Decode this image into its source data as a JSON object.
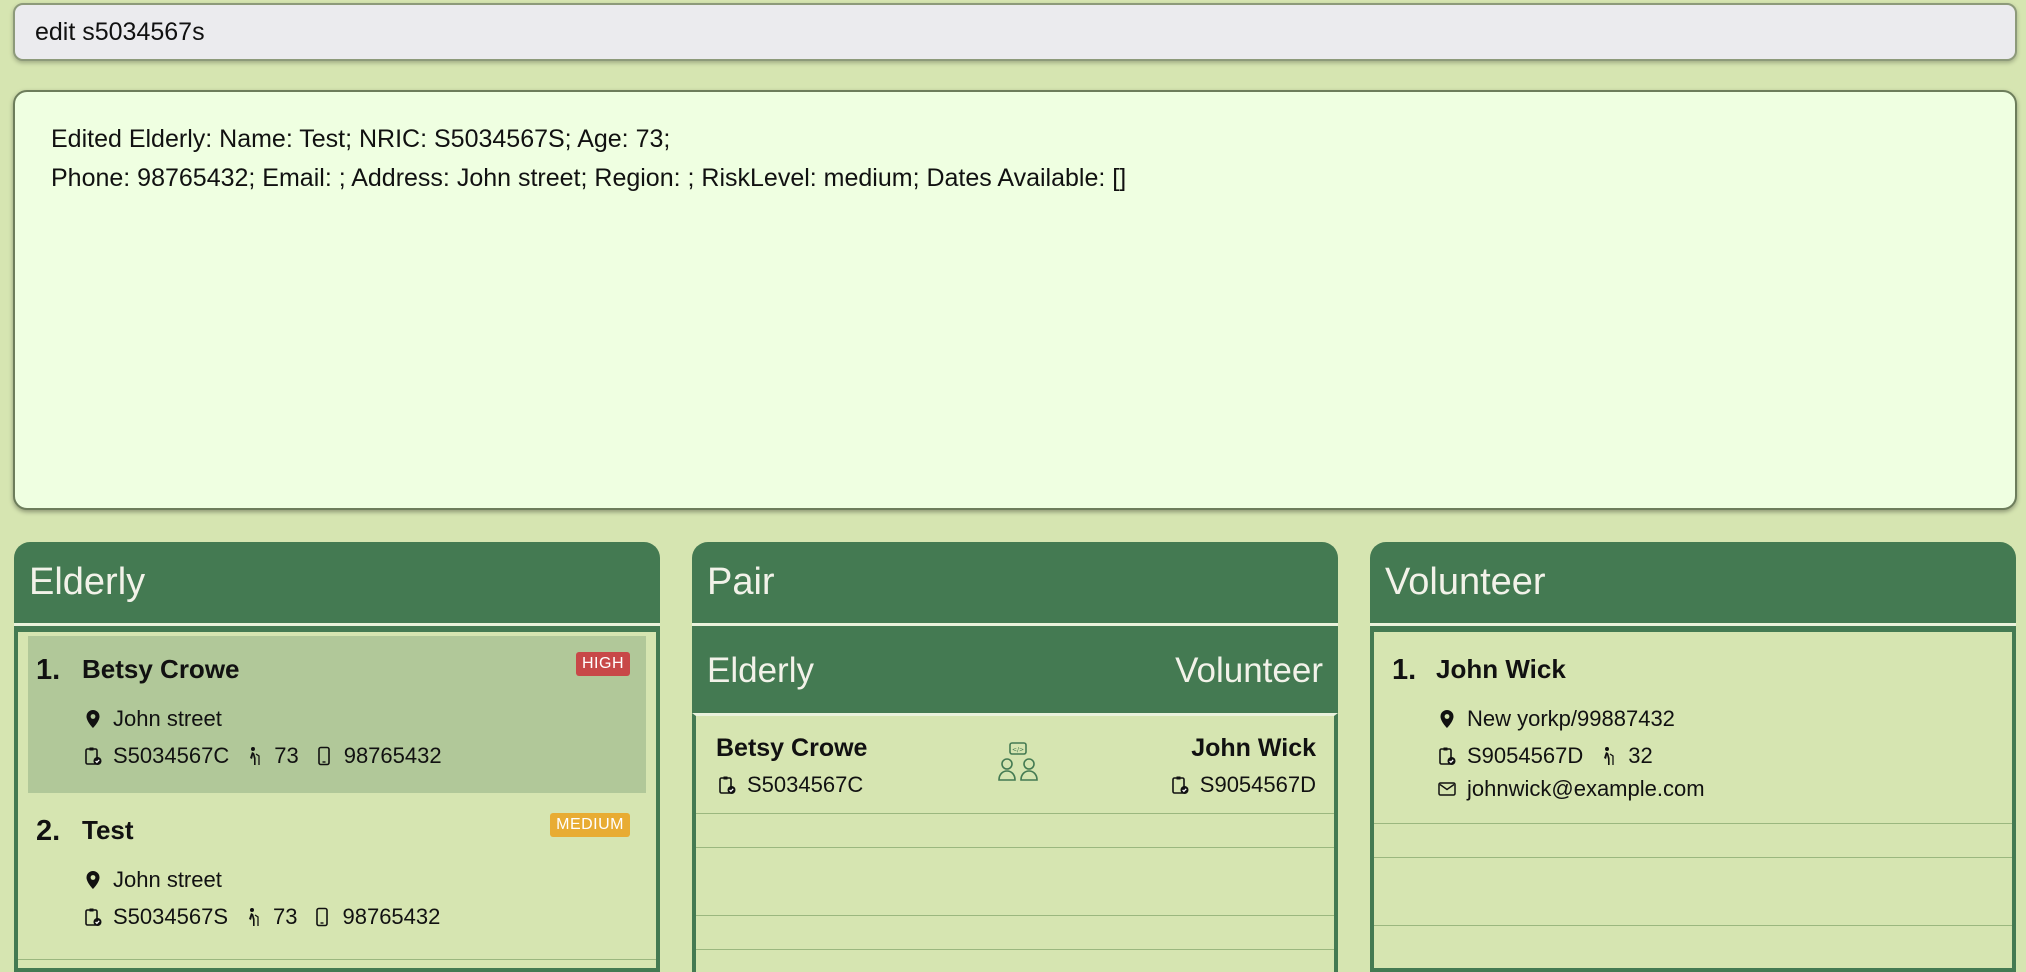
{
  "command": {
    "value": "edit s5034567s"
  },
  "result": {
    "line1": "Edited Elderly: Name: Test; NRIC: S5034567S; Age: 73;",
    "line2": "Phone: 98765432; Email: ; Address: John street; Region: ; RiskLevel: medium; Dates Available: []"
  },
  "elderly_panel": {
    "title": "Elderly",
    "items": [
      {
        "index": "1.",
        "name": "Betsy Crowe",
        "risk": "HIGH",
        "address": "John street",
        "nric": "S5034567C",
        "age": "73",
        "phone": "98765432"
      },
      {
        "index": "2.",
        "name": "Test",
        "risk": "MEDIUM",
        "address": "John street",
        "nric": "S5034567S",
        "age": "73",
        "phone": "98765432"
      }
    ]
  },
  "pair_panel": {
    "title": "Pair",
    "col_elderly": "Elderly",
    "col_volunteer": "Volunteer",
    "items": [
      {
        "elderly_name": "Betsy Crowe",
        "elderly_nric": "S5034567C",
        "volunteer_name": "John Wick",
        "volunteer_nric": "S9054567D"
      }
    ]
  },
  "volunteer_panel": {
    "title": "Volunteer",
    "items": [
      {
        "index": "1.",
        "name": "John Wick",
        "address": "New yorkp/99887432",
        "nric": "S9054567D",
        "age": "32",
        "email": "johnwick@example.com"
      }
    ]
  },
  "colors": {
    "background": "#d6e5b1",
    "panel_header": "#447a52",
    "result_bg": "#efffe1",
    "risk_high": "#c84848",
    "risk_medium": "#e8ac33",
    "selected_row": "#b1c899"
  },
  "icons": [
    "location-pin-icon",
    "id-badge-icon",
    "age-walker-icon",
    "phone-icon",
    "pair-people-icon",
    "email-icon"
  ]
}
